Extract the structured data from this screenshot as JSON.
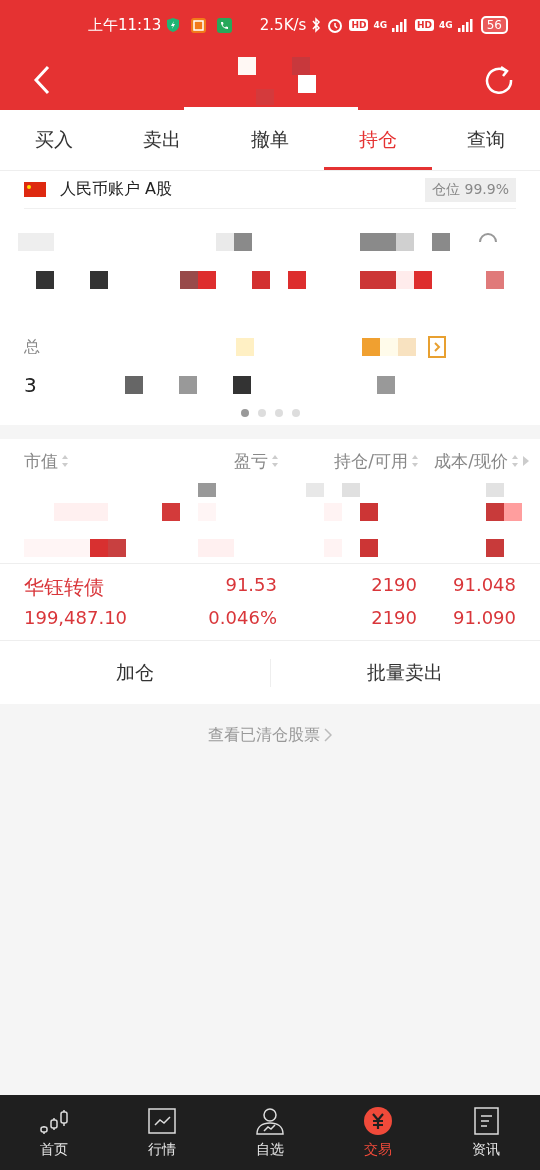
{
  "status_bar": {
    "time": "上午11:13",
    "speed": "2.5K/s",
    "sim1_label": "HD",
    "sim1_network": "4G",
    "sim2_label": "HD",
    "sim2_network": "4G",
    "battery": "56"
  },
  "tabs": [
    {
      "label": "买入",
      "selected": false
    },
    {
      "label": "卖出",
      "selected": false
    },
    {
      "label": "撤单",
      "selected": false
    },
    {
      "label": "持仓",
      "selected": true
    },
    {
      "label": "查询",
      "selected": false
    }
  ],
  "account": {
    "name": "人民币账户 A股",
    "position": "仓位 99.9%"
  },
  "summary": {
    "label": "总",
    "value": "3"
  },
  "pager": [
    {
      "selected": true
    },
    {
      "selected": false
    },
    {
      "selected": false
    },
    {
      "selected": false
    }
  ],
  "table": {
    "columns": [
      "市值",
      "盈亏",
      "持仓/可用",
      "成本/现价"
    ],
    "rows": [
      {
        "name": "华钰转债",
        "market_value": "199,487.10",
        "profit": "91.53",
        "profit_rate": "0.046%",
        "holding": "2190",
        "available": "2190",
        "cost": "91.048",
        "price": "91.090"
      }
    ]
  },
  "actions": [
    "加仓",
    "批量卖出"
  ],
  "cleared_link": "查看已清仓股票",
  "bottom_nav": [
    {
      "label": "首页",
      "kind": "candles",
      "selected": false
    },
    {
      "label": "行情",
      "kind": "chart",
      "selected": false
    },
    {
      "label": "自选",
      "kind": "person",
      "selected": false
    },
    {
      "label": "交易",
      "kind": "yuan",
      "selected": true
    },
    {
      "label": "资讯",
      "kind": "doc",
      "selected": false
    }
  ]
}
